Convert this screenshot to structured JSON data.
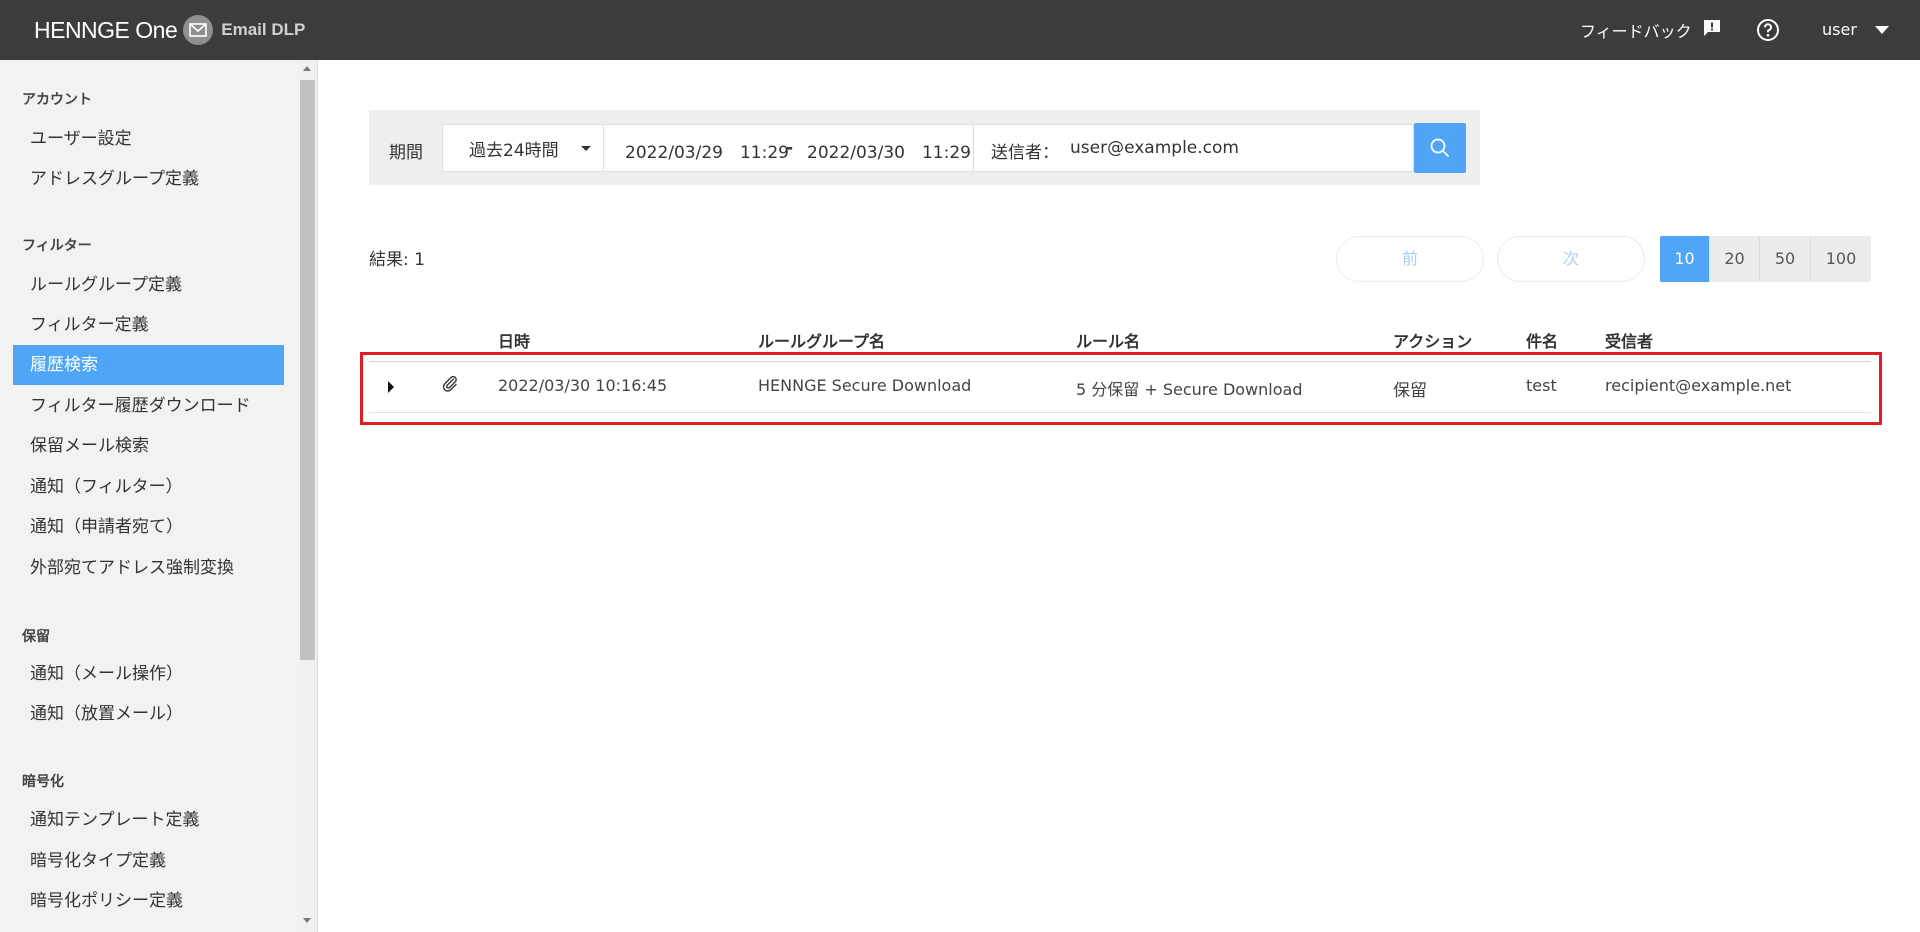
{
  "header": {
    "brand_name": "HENNGE One",
    "product_name": "Email DLP",
    "feedback_label": "フィードバック",
    "user_label": "user"
  },
  "sidebar": {
    "sections": [
      {
        "title": "アカウント",
        "items": [
          "ユーザー設定",
          "アドレスグループ定義"
        ]
      },
      {
        "title": "フィルター",
        "items": [
          "ルールグループ定義",
          "フィルター定義",
          "履歴検索",
          "フィルター履歴ダウンロード",
          "保留メール検索",
          "通知（フィルター）",
          "通知（申請者宛て）",
          "外部宛てアドレス強制変換"
        ]
      },
      {
        "title": "保留",
        "items": [
          "通知（メール操作）",
          "通知（放置メール）"
        ]
      },
      {
        "title": "暗号化",
        "items": [
          "通知テンプレート定義",
          "暗号化タイプ定義",
          "暗号化ポリシー定義"
        ]
      }
    ],
    "active_item": "履歴検索"
  },
  "search": {
    "period_label": "期間",
    "period_value": "過去24時間",
    "date_from": "2022/03/29　11:29",
    "date_separator": "-",
    "date_to": "2022/03/30　11:29",
    "sender_label": "送信者：",
    "sender_value": "user@example.com"
  },
  "results": {
    "count_label": "結果: 1",
    "prev_label": "前",
    "next_label": "次",
    "page_sizes": [
      "10",
      "20",
      "50",
      "100"
    ],
    "selected_page_size": "10"
  },
  "table": {
    "columns": [
      "日時",
      "ルールグループ名",
      "ルール名",
      "アクション",
      "件名",
      "受信者"
    ],
    "rows": [
      {
        "datetime": "2022/03/30 10:16:45",
        "rule_group": "HENNGE Secure Download",
        "rule_name": "5 分保留 + Secure Download",
        "action": "保留",
        "subject": "test",
        "recipient": "recipient@example.net"
      }
    ]
  },
  "colors": {
    "topbar": "#3c3c3c",
    "accent": "#4fa6f6",
    "highlight": "#e31b23"
  }
}
